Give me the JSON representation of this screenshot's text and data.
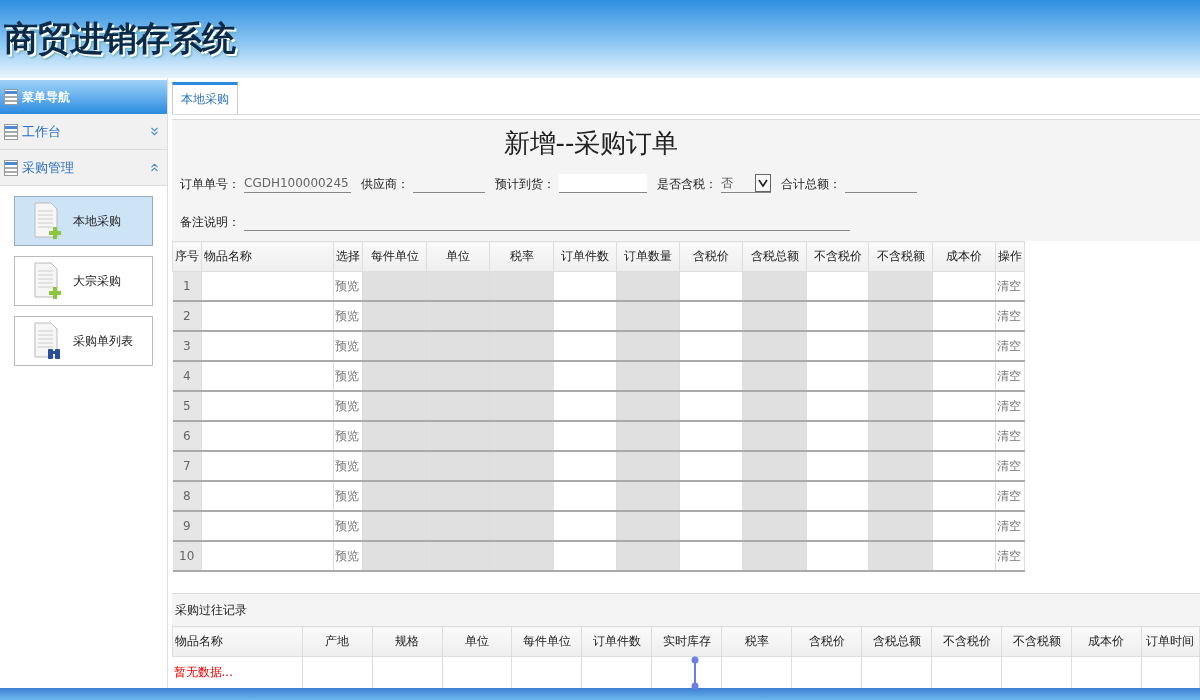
{
  "app_title": "商贸进销存系统",
  "sidebar": {
    "title": "菜单导航",
    "groups": [
      {
        "label": "工作台",
        "expanded": false
      },
      {
        "label": "采购管理",
        "expanded": true,
        "items": [
          {
            "label": "本地采购",
            "selected": true,
            "kind": "add"
          },
          {
            "label": "大宗采购",
            "selected": false,
            "kind": "add"
          },
          {
            "label": "采购单列表",
            "selected": false,
            "kind": "list"
          }
        ]
      }
    ]
  },
  "tabs": [
    {
      "label": "本地采购",
      "selected": true
    }
  ],
  "form": {
    "title": "新增--采购订单",
    "fields": [
      {
        "label": "订单单号：",
        "value": "CGDH100000245",
        "kind": "text"
      },
      {
        "label": "供应商：",
        "kind": "text"
      },
      {
        "label": "预计到货：",
        "kind": "date"
      },
      {
        "label": "是否含税：",
        "value": "否",
        "kind": "select"
      },
      {
        "label": "合计总额：",
        "kind": "text"
      }
    ],
    "remark": {
      "label": "备注说明："
    }
  },
  "order_table": {
    "columns": [
      {
        "label": "序号"
      },
      {
        "label": "物品名称",
        "shaded": false
      },
      {
        "label": "选择"
      },
      {
        "label": "每件单位",
        "shaded": true
      },
      {
        "label": "单位",
        "shaded": true
      },
      {
        "label": "税率",
        "shaded": true
      },
      {
        "label": "订单件数",
        "shaded": false
      },
      {
        "label": "订单数量",
        "shaded": true
      },
      {
        "label": "含税价",
        "shaded": false
      },
      {
        "label": "含税总额",
        "shaded": true
      },
      {
        "label": "不含税价",
        "shaded": false
      },
      {
        "label": "不含税额",
        "shaded": true
      },
      {
        "label": "成本价",
        "shaded": false
      },
      {
        "label": "操作"
      }
    ],
    "rows": [
      {
        "number": "1",
        "preview": "预览",
        "clear": "清空"
      },
      {
        "number": "2",
        "preview": "预览",
        "clear": "清空"
      },
      {
        "number": "3",
        "preview": "预览",
        "clear": "清空"
      },
      {
        "number": "4",
        "preview": "预览",
        "clear": "清空"
      },
      {
        "number": "5",
        "preview": "预览",
        "clear": "清空"
      },
      {
        "number": "6",
        "preview": "预览",
        "clear": "清空"
      },
      {
        "number": "7",
        "preview": "预览",
        "clear": "清空"
      },
      {
        "number": "8",
        "preview": "预览",
        "clear": "清空"
      },
      {
        "number": "9",
        "preview": "预览",
        "clear": "清空"
      },
      {
        "number": "10",
        "preview": "预览",
        "clear": "清空"
      }
    ]
  },
  "history": {
    "title": "采购过往记录",
    "columns": [
      "物品名称",
      "产地",
      "规格",
      "单位",
      "每件单位",
      "订单件数",
      "实时库存",
      "税率",
      "含税价",
      "含税总额",
      "不含税价",
      "不含税额",
      "成本价",
      "订单时间"
    ],
    "empty_text": "暂无数据..."
  }
}
